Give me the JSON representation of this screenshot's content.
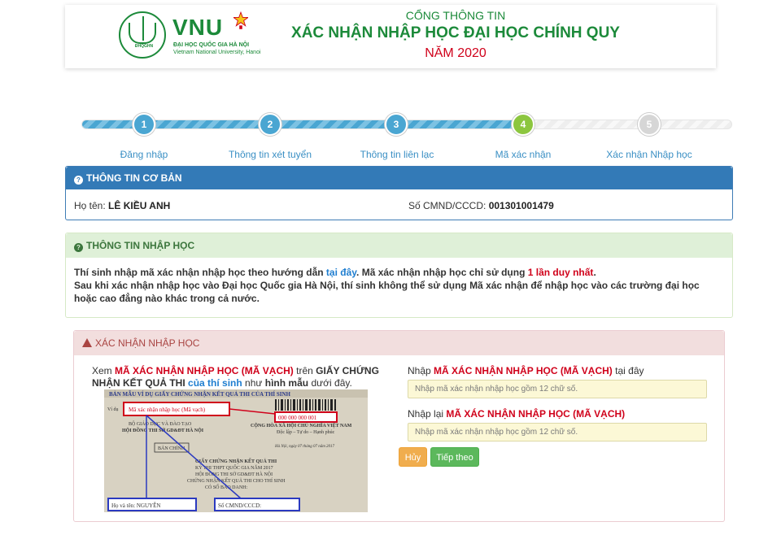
{
  "header": {
    "logo_text": "VNU",
    "logo_seal_text": "ĐHQGHN",
    "logo_sub1": "ĐẠI HỌC QUỐC GIA HÀ NỘI",
    "logo_sub2": "Vietnam National University, Hanoi",
    "portal": "CỔNG THÔNG TIN",
    "title": "XÁC NHẬN NHẬP HỌC ĐẠI HỌC CHÍNH QUY",
    "year": "NĂM 2020"
  },
  "stepper": {
    "progress": 0.68,
    "current_step": 4,
    "steps": [
      {
        "number": "1",
        "label": "Đăng nhập",
        "color": "#4aa6d2"
      },
      {
        "number": "2",
        "label": "Thông tin xét tuyển",
        "color": "#4aa6d2"
      },
      {
        "number": "3",
        "label": "Thông tin liên lạc",
        "color": "#4aa6d2"
      },
      {
        "number": "4",
        "label": "Mã xác nhận",
        "color": "#8cc63f"
      },
      {
        "number": "5",
        "label": "Xác nhận Nhập học",
        "color": "#d6d6d6"
      }
    ]
  },
  "basic_info": {
    "heading": "THÔNG TIN CƠ BẢN",
    "name_label": "Họ tên:",
    "name_value": "LÊ KIỀU ANH",
    "id_label": "Số CMND/CCCD:",
    "id_value": "001301001479"
  },
  "enroll_info": {
    "heading": "THÔNG TIN NHẬP HỌC",
    "line1_a": "Thí sinh nhập mã xác nhận nhập học theo hướng dẫn ",
    "line1_link": "tại đây",
    "line1_b": ". Mã xác nhận nhập học chỉ sử dụng ",
    "line1_red": "1 lần duy nhất",
    "line1_c": ".",
    "line2": "Sau khi xác nhận nhập học vào Đại học Quốc gia Hà Nội, thí sinh không thể sử dụng Mã xác nhận để nhập học vào các trường đại học hoặc cao đẳng nào khác trong cả nước."
  },
  "confirm": {
    "heading": "XÁC NHẬN NHẬP HỌC",
    "intro_a": "Xem ",
    "intro_red": "MÃ XÁC NHẬN NHẬP HỌC (MÃ VẠCH)",
    "intro_b": " trên ",
    "intro_bold": "GIẤY CHỨNG NHẬN KẾT QUẢ THI",
    "intro_c": " ",
    "intro_blue": "của thí sinh",
    "intro_d": " như ",
    "intro_bold2": "hình mẫu",
    "intro_e": " dưới đây.",
    "sample": {
      "header": "BẢN MẪU VÍ DỤ GIẤY CHỨNG NHẬN KẾT QUẢ THI CỦA THÍ SINH",
      "code_label": "Mã xác nhận nhập học (Mã vạch)",
      "code_value": "000 000 000 001",
      "vi_du": "Ví dụ",
      "left1": "BỘ GIÁO DỤC VÀ ĐÀO TẠO",
      "left2": "HỘI ĐỒNG THI SỞ GD&ĐT HÀ NỘI",
      "right1": "CỘNG HÒA XÃ HỘI CHỦ NGHĨA VIỆT NAM",
      "right2": "Độc lập – Tự do – Hạnh phúc",
      "date": "Hà Nội, ngày 07 tháng 07 năm 2017",
      "stamp": "BẢN CHÍNH",
      "cert1": "GIẤY CHỨNG NHẬN KẾT QUẢ THI",
      "cert2": "KỲ THI THPT QUỐC GIA NĂM 2017",
      "cert3": "HỘI ĐỒNG THI SỞ GD&ĐT HÀ NỘI",
      "cert4": "CHỨNG NHẬN KẾT QUẢ THI CHO THÍ SINH",
      "cert5": "CÓ SỐ BÁO DANH:",
      "name_box": "Họ và tên: NGUYỄN",
      "id_box": "Số CMND/CCCD:"
    },
    "field1_a": "Nhập ",
    "field1_red": "MÃ XÁC NHẬN NHẬP HỌC (MÃ VẠCH)",
    "field1_b": " tại đây",
    "field1_placeholder": "Nhập mã xác nhận nhập học gồm 12 chữ số.",
    "field2_a": "Nhập lại ",
    "field2_red": "MÃ XÁC NHẬN NHẬP HỌC (MÃ VẠCH)",
    "field2_placeholder": "Nhập mã xác nhận nhập học gồm 12 chữ số.",
    "cancel_label": "Hủy",
    "next_label": "Tiếp theo"
  }
}
